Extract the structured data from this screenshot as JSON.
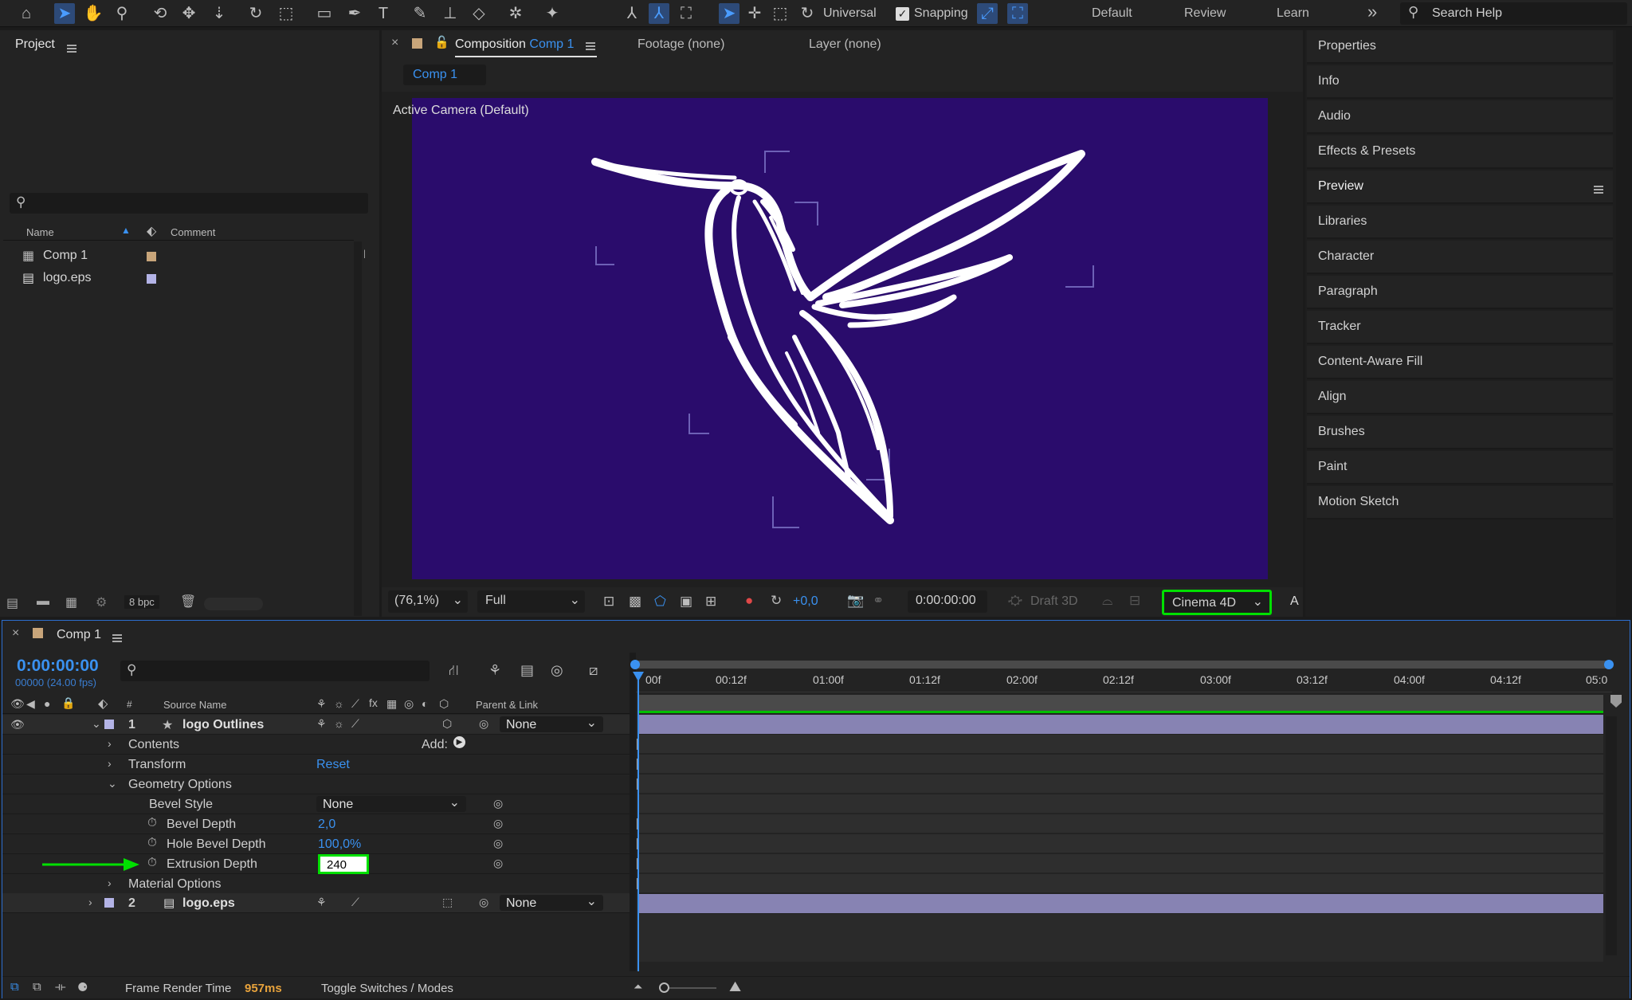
{
  "toolbar": {
    "universal_label": "Universal",
    "snapping_label": "Snapping",
    "workspaces": [
      "Default",
      "Review",
      "Learn"
    ],
    "overflow": "»",
    "search_placeholder": "Search Help"
  },
  "project": {
    "title": "Project",
    "columns": {
      "name": "Name",
      "comment": "Comment"
    },
    "items": [
      {
        "name": "Comp 1",
        "color": "#c8a57a"
      },
      {
        "name": "logo.eps",
        "color": "#b3b3e6"
      }
    ],
    "bpc": "8 bpc"
  },
  "viewer": {
    "tabs": {
      "composition_prefix": "Composition",
      "composition_name": "Comp 1",
      "footage": "Footage (none)",
      "layer": "Layer (none)"
    },
    "subtab": "Comp 1",
    "camera_label": "Active Camera (Default)",
    "bg_color": "#2a0c6c",
    "bottom": {
      "zoom": "(76,1%)",
      "resolution": "Full",
      "exposure": "+0,0",
      "timecode": "0:00:00:00",
      "draft3d": "Draft 3D",
      "renderer": "Cinema 4D",
      "extra": "A"
    }
  },
  "right_panel": {
    "items": [
      "Properties",
      "Info",
      "Audio",
      "Effects & Presets",
      "Preview",
      "Libraries",
      "Character",
      "Paragraph",
      "Tracker",
      "Content-Aware Fill",
      "Align",
      "Brushes",
      "Paint",
      "Motion Sketch"
    ]
  },
  "timeline": {
    "comp_name": "Comp 1",
    "timecode": "0:00:00:00",
    "frame_info": "00000 (24.00 fps)",
    "headers": {
      "num": "#",
      "source": "Source Name",
      "parent": "Parent & Link"
    },
    "ruler": [
      "00f",
      "00:12f",
      "01:00f",
      "01:12f",
      "02:00f",
      "02:12f",
      "03:00f",
      "03:12f",
      "04:00f",
      "04:12f",
      "05:0"
    ],
    "layer1": {
      "num": "1",
      "name": "logo Outlines",
      "parent": "None"
    },
    "props": {
      "contents": "Contents",
      "add_label": "Add:",
      "transform": "Transform",
      "reset": "Reset",
      "geometry": "Geometry Options",
      "bevel_style_label": "Bevel Style",
      "bevel_style_value": "None",
      "bevel_depth_label": "Bevel Depth",
      "bevel_depth_value": "2,0",
      "hole_bevel_label": "Hole Bevel Depth",
      "hole_bevel_value": "100,0%",
      "extrusion_label": "Extrusion Depth",
      "extrusion_value": "240",
      "material": "Material Options"
    },
    "layer2": {
      "num": "2",
      "name": "logo.eps",
      "parent": "None"
    },
    "footer": {
      "render_label": "Frame Render Time",
      "render_value": "957ms",
      "toggle_label": "Toggle Switches / Modes"
    }
  },
  "colors": {
    "accent": "#3a91f0",
    "highlight": "#00e000",
    "render_time": "#e8a33c"
  }
}
